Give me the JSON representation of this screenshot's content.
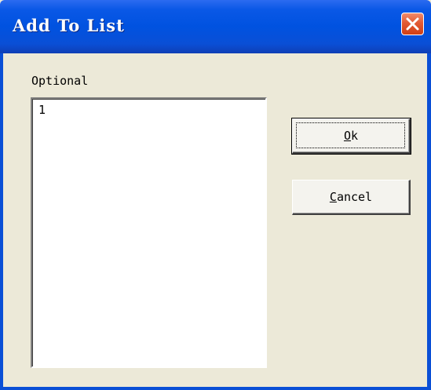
{
  "window": {
    "title": "Add To List"
  },
  "form": {
    "label": "Optional",
    "list_items": [
      "1"
    ]
  },
  "buttons": {
    "ok_mnemonic": "O",
    "ok_rest": "k",
    "cancel_mnemonic": "C",
    "cancel_rest": "ancel"
  },
  "colors": {
    "title_bar": "#0052e0",
    "close_button": "#e25a34",
    "dialog_bg": "#ece9d8"
  },
  "icons": {
    "close": "close-icon"
  }
}
